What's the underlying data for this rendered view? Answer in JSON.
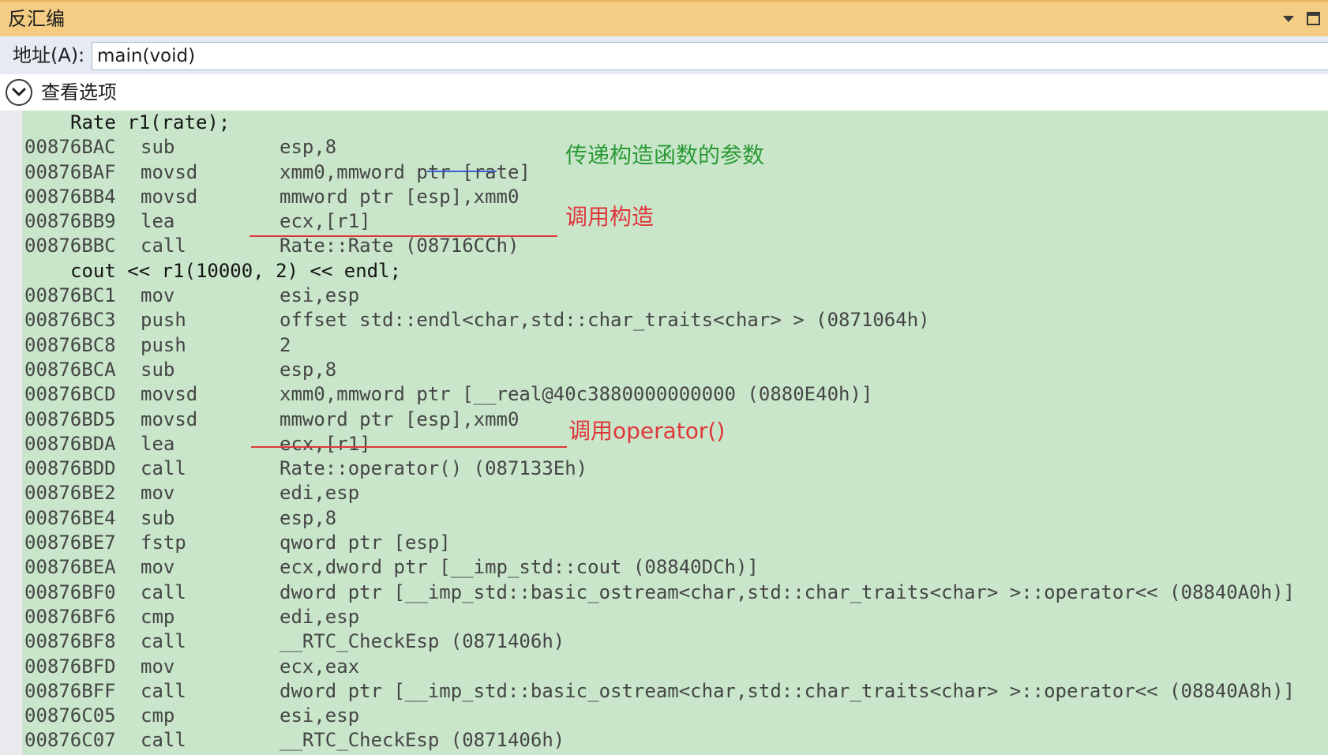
{
  "window": {
    "title": "反汇编"
  },
  "address_bar": {
    "label": "地址(A):",
    "value": "main(void)"
  },
  "view_options": {
    "label": "查看选项"
  },
  "colors": {
    "title_bg": "#f5cc84",
    "code_bg": "#c9e6cb",
    "annotation_green": "#2a9a34",
    "annotation_red": "#e0363a",
    "underline_blue": "#3a5fcf",
    "underline_red": "#e0363a"
  },
  "code": [
    {
      "kind": "source",
      "text": "Rate r1(rate);"
    },
    {
      "kind": "asm",
      "address": "00876BAC",
      "mnemonic": "sub",
      "operands": "esp,8"
    },
    {
      "kind": "asm",
      "address": "00876BAF",
      "mnemonic": "movsd",
      "operands": "xmm0,mmword ptr [rate]"
    },
    {
      "kind": "asm",
      "address": "00876BB4",
      "mnemonic": "movsd",
      "operands": "mmword ptr [esp],xmm0"
    },
    {
      "kind": "asm",
      "address": "00876BB9",
      "mnemonic": "lea",
      "operands": "ecx,[r1]"
    },
    {
      "kind": "asm",
      "address": "00876BBC",
      "mnemonic": "call",
      "operands": "Rate::Rate (08716CCh)"
    },
    {
      "kind": "source",
      "text": "cout << r1(10000, 2) << endl;"
    },
    {
      "kind": "asm",
      "address": "00876BC1",
      "mnemonic": "mov",
      "operands": "esi,esp"
    },
    {
      "kind": "asm",
      "address": "00876BC3",
      "mnemonic": "push",
      "operands": "offset std::endl<char,std::char_traits<char> > (0871064h)"
    },
    {
      "kind": "asm",
      "address": "00876BC8",
      "mnemonic": "push",
      "operands": "2"
    },
    {
      "kind": "asm",
      "address": "00876BCA",
      "mnemonic": "sub",
      "operands": "esp,8"
    },
    {
      "kind": "asm",
      "address": "00876BCD",
      "mnemonic": "movsd",
      "operands": "xmm0,mmword ptr [__real@40c3880000000000 (0880E40h)]"
    },
    {
      "kind": "asm",
      "address": "00876BD5",
      "mnemonic": "movsd",
      "operands": "mmword ptr [esp],xmm0"
    },
    {
      "kind": "asm",
      "address": "00876BDA",
      "mnemonic": "lea",
      "operands": "ecx,[r1]"
    },
    {
      "kind": "asm",
      "address": "00876BDD",
      "mnemonic": "call",
      "operands": "Rate::operator() (087133Eh)"
    },
    {
      "kind": "asm",
      "address": "00876BE2",
      "mnemonic": "mov",
      "operands": "edi,esp"
    },
    {
      "kind": "asm",
      "address": "00876BE4",
      "mnemonic": "sub",
      "operands": "esp,8"
    },
    {
      "kind": "asm",
      "address": "00876BE7",
      "mnemonic": "fstp",
      "operands": "qword ptr [esp]"
    },
    {
      "kind": "asm",
      "address": "00876BEA",
      "mnemonic": "mov",
      "operands": "ecx,dword ptr [__imp_std::cout (08840DCh)]"
    },
    {
      "kind": "asm",
      "address": "00876BF0",
      "mnemonic": "call",
      "operands": "dword ptr [__imp_std::basic_ostream<char,std::char_traits<char> >::operator<< (08840A0h)]"
    },
    {
      "kind": "asm",
      "address": "00876BF6",
      "mnemonic": "cmp",
      "operands": "edi,esp"
    },
    {
      "kind": "asm",
      "address": "00876BF8",
      "mnemonic": "call",
      "operands": "__RTC_CheckEsp (0871406h)"
    },
    {
      "kind": "asm",
      "address": "00876BFD",
      "mnemonic": "mov",
      "operands": "ecx,eax"
    },
    {
      "kind": "asm",
      "address": "00876BFF",
      "mnemonic": "call",
      "operands": "dword ptr [__imp_std::basic_ostream<char,std::char_traits<char> >::operator<< (08840A8h)]"
    },
    {
      "kind": "asm",
      "address": "00876C05",
      "mnemonic": "cmp",
      "operands": "esi,esp"
    },
    {
      "kind": "asm",
      "address": "00876C07",
      "mnemonic": "call",
      "operands": "__RTC_CheckEsp (0871406h)"
    }
  ],
  "annotations": {
    "pass_ctor_args": "传递构造函数的参数",
    "call_ctor": "调用构造",
    "call_operator": "调用operator()"
  }
}
